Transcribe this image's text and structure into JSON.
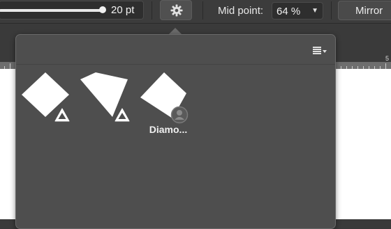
{
  "toolbar": {
    "width_value": "20 pt",
    "midpoint_label": "Mid point:",
    "midpoint_value": "64 %",
    "mirror_label": "Mirror"
  },
  "presets": [
    {
      "icon": "diamond-shape-icon",
      "badge": "triangle-badge-icon",
      "label": ""
    },
    {
      "icon": "kite-shape-icon",
      "badge": "triangle-badge-icon",
      "label": ""
    },
    {
      "icon": "diamond-shape-icon",
      "badge": "user-badge-icon",
      "label": "Diamo..."
    }
  ],
  "ruler_number": "5",
  "colors": {
    "toolbar_bg": "#3c3c3c",
    "popover_bg": "#4e4e4e",
    "canvas": "#ffffff"
  }
}
